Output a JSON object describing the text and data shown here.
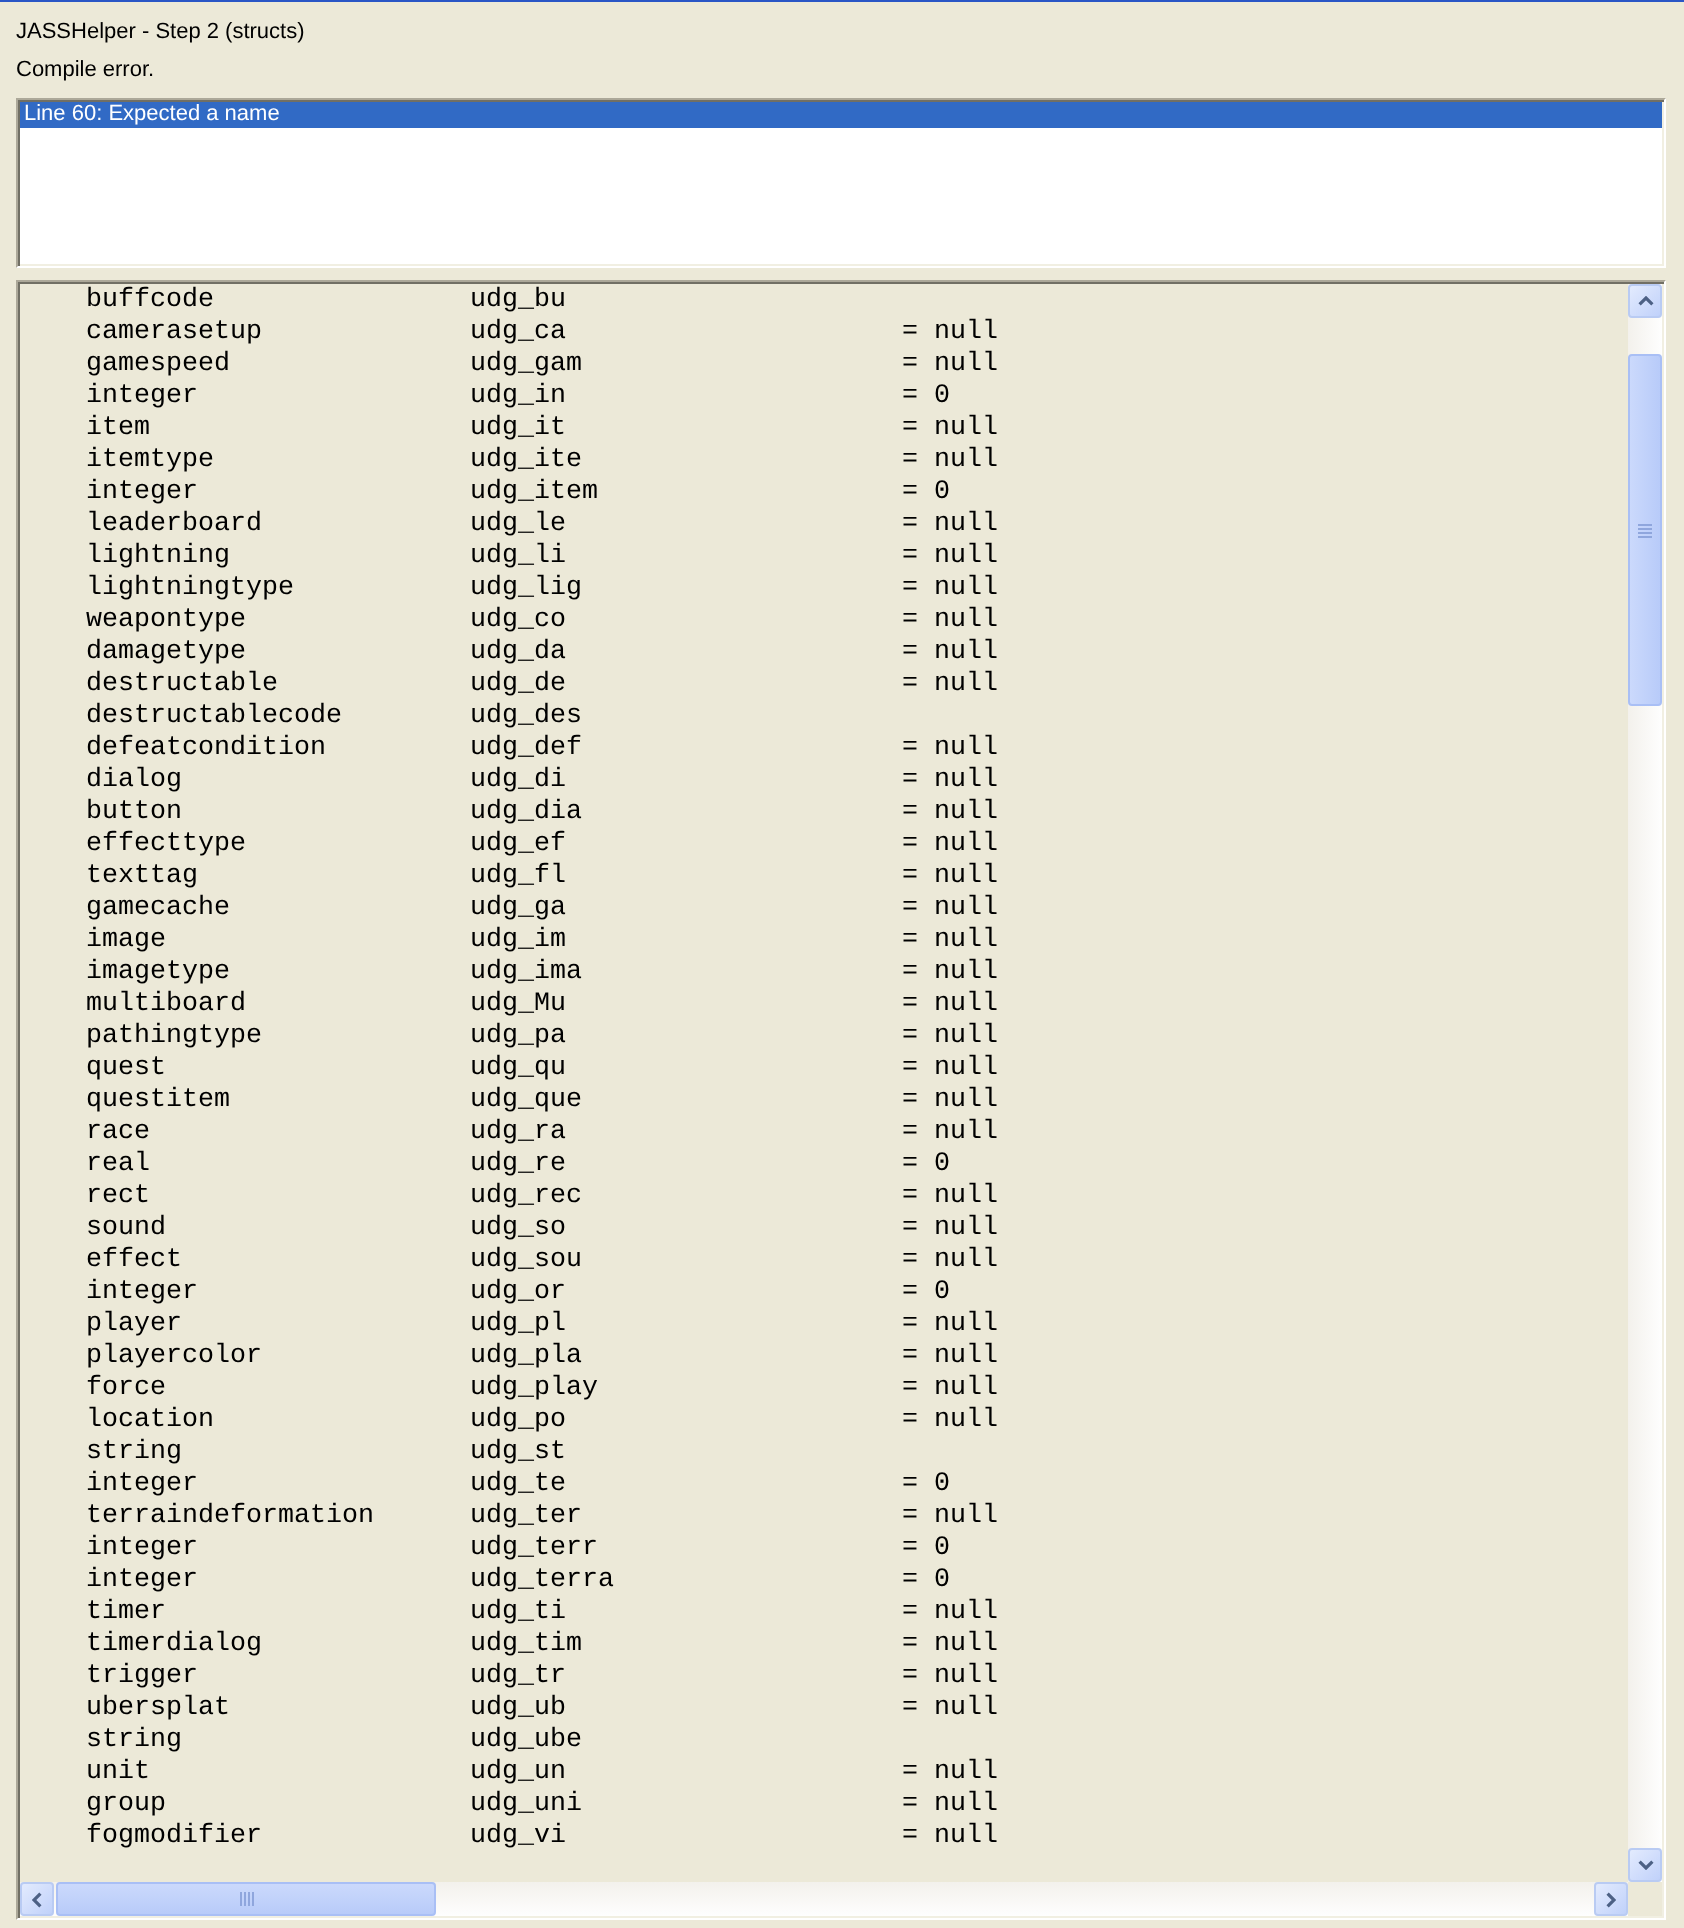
{
  "window": {
    "title": "JASSHelper - Step 2 (structs)"
  },
  "status": "Compile error.",
  "errors": [
    {
      "text": "Line 60: Expected a name",
      "selected": true
    }
  ],
  "code_lines": [
    {
      "type": "buffcode",
      "name": "udg_bu"
    },
    {
      "type": "camerasetup",
      "name": "udg_ca",
      "value": "= null"
    },
    {
      "type": "gamespeed",
      "name": "udg_gam",
      "value": "= null"
    },
    {
      "type": "integer",
      "name": "udg_in",
      "value": "= 0"
    },
    {
      "type": "item",
      "name": "udg_it",
      "value": "= null"
    },
    {
      "type": "itemtype",
      "name": "udg_ite",
      "value": "= null"
    },
    {
      "type": "integer",
      "name": "udg_item",
      "value": "= 0"
    },
    {
      "type": "leaderboard",
      "name": "udg_le",
      "value": "= null"
    },
    {
      "type": "lightning",
      "name": "udg_li",
      "value": "= null"
    },
    {
      "type": "lightningtype",
      "name": "udg_lig",
      "value": "= null"
    },
    {
      "type": "weapontype",
      "name": "udg_co",
      "value": "= null"
    },
    {
      "type": "damagetype",
      "name": "udg_da",
      "value": "= null"
    },
    {
      "type": "destructable",
      "name": "udg_de",
      "value": "= null"
    },
    {
      "type": "destructablecode",
      "name": "udg_des"
    },
    {
      "type": "defeatcondition",
      "name": "udg_def",
      "value": "= null"
    },
    {
      "type": "dialog",
      "name": "udg_di",
      "value": "= null"
    },
    {
      "type": "button",
      "name": "udg_dia",
      "value": "= null"
    },
    {
      "type": "effecttype",
      "name": "udg_ef",
      "value": "= null"
    },
    {
      "type": "texttag",
      "name": "udg_fl",
      "value": "= null"
    },
    {
      "type": "gamecache",
      "name": "udg_ga",
      "value": "= null"
    },
    {
      "type": "image",
      "name": "udg_im",
      "value": "= null"
    },
    {
      "type": "imagetype",
      "name": "udg_ima",
      "value": "= null"
    },
    {
      "type": "multiboard",
      "name": "udg_Mu",
      "value": "= null"
    },
    {
      "type": "pathingtype",
      "name": "udg_pa",
      "value": "= null"
    },
    {
      "type": "quest",
      "name": "udg_qu",
      "value": "= null"
    },
    {
      "type": "questitem",
      "name": "udg_que",
      "value": "= null"
    },
    {
      "type": "race",
      "name": "udg_ra",
      "value": "= null"
    },
    {
      "type": "real",
      "name": "udg_re",
      "value": "= 0"
    },
    {
      "type": "rect",
      "name": "udg_rec",
      "value": "= null"
    },
    {
      "type": "sound",
      "name": "udg_so",
      "value": "= null"
    },
    {
      "type": "effect",
      "name": "udg_sou",
      "value": "= null"
    },
    {
      "type": "integer",
      "name": "udg_or",
      "value": "= 0"
    },
    {
      "type": "player",
      "name": "udg_pl",
      "value": "= null"
    },
    {
      "type": "playercolor",
      "name": "udg_pla",
      "value": "= null"
    },
    {
      "type": "force",
      "name": "udg_play",
      "value": "= null"
    },
    {
      "type": "location",
      "name": "udg_po",
      "value": "= null"
    },
    {
      "type": "string",
      "name": "udg_st"
    },
    {
      "type": "integer",
      "name": "udg_te",
      "value": "= 0"
    },
    {
      "type": "terraindeformation",
      "name": "udg_ter",
      "value": "= null"
    },
    {
      "type": "integer",
      "name": "udg_terr",
      "value": "= 0"
    },
    {
      "type": "integer",
      "name": "udg_terra",
      "value": "= 0"
    },
    {
      "type": "timer",
      "name": "udg_ti",
      "value": "= null"
    },
    {
      "type": "timerdialog",
      "name": "udg_tim",
      "value": "= null"
    },
    {
      "type": "trigger",
      "name": "udg_tr",
      "value": "= null"
    },
    {
      "type": "ubersplat",
      "name": "udg_ub",
      "value": "= null"
    },
    {
      "type": "string",
      "name": "udg_ube"
    },
    {
      "type": "unit",
      "name": "udg_un",
      "value": "= null"
    },
    {
      "type": "group",
      "name": "udg_uni",
      "value": "= null"
    },
    {
      "type": "fogmodifier",
      "name": "udg_vi",
      "value": "= null"
    }
  ]
}
